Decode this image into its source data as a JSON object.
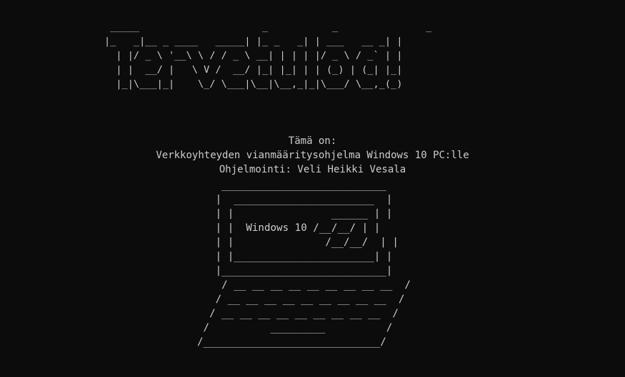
{
  "banner": {
    "ascii": " _____                     _           _               _ \n|_   _|__ _ ____   _____| |_ _   _| | ___   __ _| |\n  | |/ _ \\ '__\\ \\ / / _ \\ __| | | | |/ _ \\ / _` | |\n  | |  __/ |   \\ V /  __/ |_| |_| | | (_) | (_| |_|\n  |_|\\___|_|    \\_/ \\___|\\__|\\__,_|_|\\___/ \\__,_(_)",
    "text": "Tervetuloa!"
  },
  "info": {
    "line1": "Tämä on:",
    "line2": "Verkkoyhteyden vianmääritysohjelma Windows 10 PC:lle",
    "line3": "Ohjelmointi: Veli Heikki Vesala"
  },
  "laptop": {
    "ascii": "    ___________________________\n   |  _______________________  |\n   | |                ______ | |\n   | |  Windows 10 /__/__/ | |\n   | |               /__/__/  | |\n   | |_______________________| |\n   |___________________________|\n    / __ __ __ __ __ __ __ __ __  /\n   / __ __ __ __ __ __ __ __ __  /\n  / __ __ __ __ __ __ __ __ __  /\n /          _________          /\n/_____________________________/",
    "label": "Windows 10"
  },
  "colors": {
    "background": "#0c0c0c",
    "text": "#cccccc"
  }
}
